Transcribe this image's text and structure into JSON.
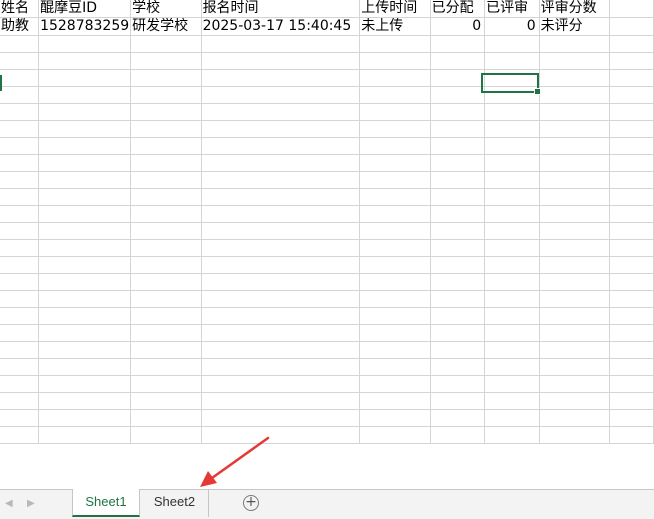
{
  "sheet": {
    "headers": [
      "姓名",
      "醌摩豆ID",
      "学校",
      "报名时间",
      "上传时间",
      "已分配",
      "已评审",
      "评审分数"
    ],
    "rows": [
      [
        "助教",
        "1528783259",
        "研发学校",
        "2025-03-17 15:40:45",
        "未上传",
        "0",
        "0",
        "未评分"
      ]
    ],
    "empty_rows": 24,
    "extra_columns": 1
  },
  "tabs": {
    "nav_prev": "◀",
    "nav_next": "▶",
    "sheet1": "Sheet1",
    "sheet2": "Sheet2",
    "add_sheet": "+"
  },
  "colors": {
    "accent": "#217346",
    "annotation_arrow": "#e53935",
    "gridline": "#d4d4d4"
  },
  "icons": {
    "add_sheet": "plus-circle-icon",
    "annotation": "red-arrow-annotation"
  }
}
